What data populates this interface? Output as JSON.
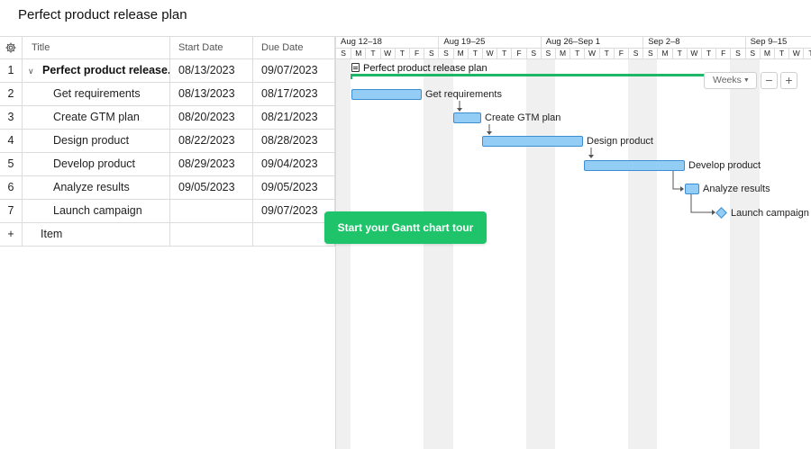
{
  "title": "Perfect product release plan",
  "columns": {
    "title": "Title",
    "start": "Start Date",
    "due": "Due Date"
  },
  "rows": [
    {
      "num": "1",
      "title": "Perfect product release...",
      "start": "08/13/2023",
      "due": "09/07/2023",
      "parent": true
    },
    {
      "num": "2",
      "title": "Get requirements",
      "start": "08/13/2023",
      "due": "08/17/2023"
    },
    {
      "num": "3",
      "title": "Create GTM plan",
      "start": "08/20/2023",
      "due": "08/21/2023"
    },
    {
      "num": "4",
      "title": "Design product",
      "start": "08/22/2023",
      "due": "08/28/2023"
    },
    {
      "num": "5",
      "title": "Develop product",
      "start": "08/29/2023",
      "due": "09/04/2023"
    },
    {
      "num": "6",
      "title": "Analyze results",
      "start": "09/05/2023",
      "due": "09/05/2023"
    },
    {
      "num": "7",
      "title": "Launch campaign",
      "start": "",
      "due": "09/07/2023"
    }
  ],
  "add_row": {
    "plus": "+",
    "label": "Item"
  },
  "timeline": {
    "weeks": [
      "Aug 12–18",
      "Aug 19–25",
      "Aug 26–Sep 1",
      "Sep 2–8",
      "Sep 9–15"
    ],
    "days": [
      "S",
      "M",
      "T",
      "W",
      "T",
      "F",
      "S"
    ]
  },
  "gantt": {
    "summary_label": "Perfect product release plan",
    "task_labels": [
      "Get requirements",
      "Create GTM plan",
      "Design product",
      "Develop product",
      "Analyze results",
      "Launch campaign"
    ]
  },
  "controls": {
    "weeks": "Weeks",
    "zoom_out": "−",
    "zoom_in": "+"
  },
  "tour_button": "Start your Gantt chart tour",
  "colors": {
    "bar_fill": "#93cdf5",
    "bar_border": "#3b8ed2",
    "summary": "#1eb668",
    "tour": "#1fc36a",
    "link": "#1a8fd6"
  }
}
